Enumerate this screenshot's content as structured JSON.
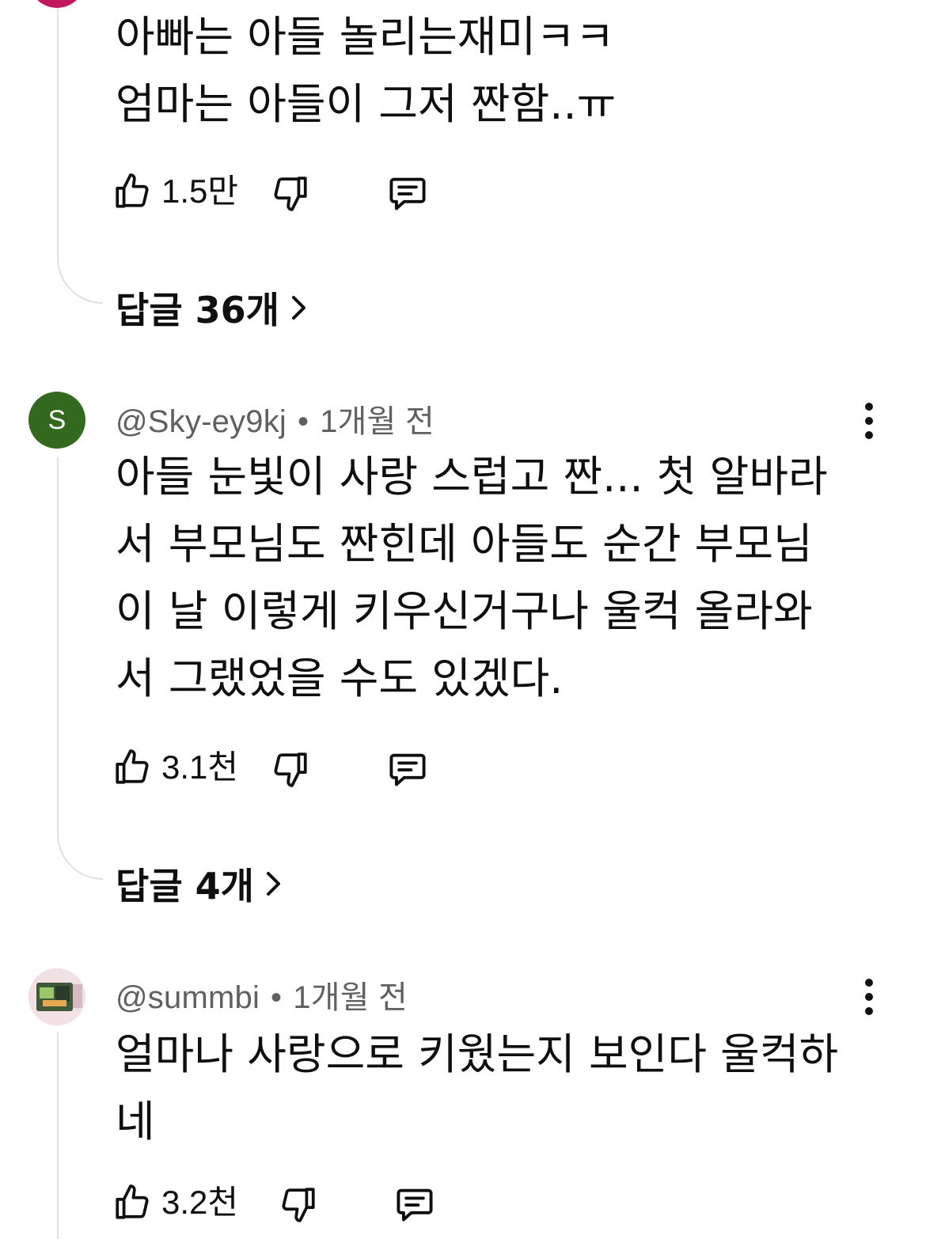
{
  "comments": [
    {
      "avatar_color": "#c2185b",
      "body_lines": [
        "아빠는 아들 놀리는재미ㅋㅋ",
        "엄마는 아들이 그저 짠함..ㅠ"
      ],
      "like_count": "1.5만",
      "replies_label": "답글 36개"
    },
    {
      "author": "@Sky-ey9kj",
      "separator": "•",
      "time": "1개월 전",
      "avatar_letter": "S",
      "avatar_color": "#33691e",
      "body_lines": [
        "아들 눈빛이 사랑 스럽고 짠... 첫 알바라",
        "서 부모님도 짠힌데 아들도 순간 부모님",
        "이 날 이렇게 키우신거구나 울컥 올라와",
        "서 그랬었을 수도 있겠다."
      ],
      "like_count": "3.1천",
      "replies_label": "답글 4개"
    },
    {
      "author": "@summbi",
      "separator": "•",
      "time": "1개월 전",
      "body_lines": [
        "얼마나 사랑으로 키웠는지 보인다 울컥하",
        "네"
      ],
      "like_count": "3.2천"
    }
  ],
  "icons": {
    "like": "thumb-up-outline-icon",
    "dislike": "thumb-down-outline-icon",
    "reply": "comment-reply-icon",
    "more": "more-vertical-icon",
    "chevron": "chevron-right-icon"
  }
}
